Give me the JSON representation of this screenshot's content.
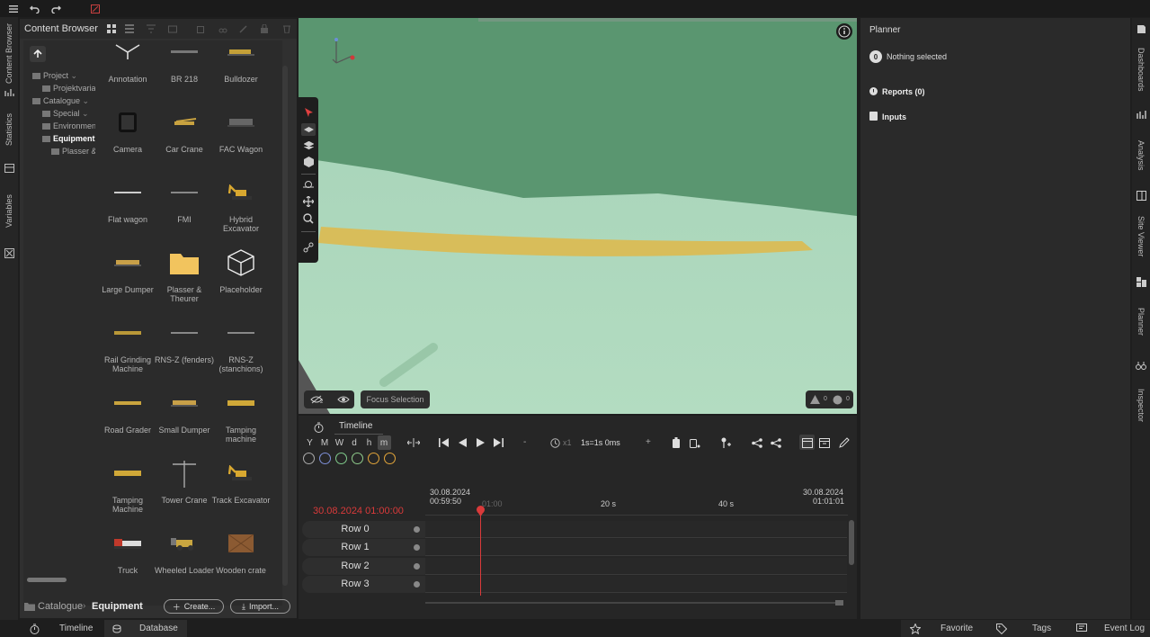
{
  "toolbar": {
    "menu_icon": "hamburger-icon",
    "undo_icon": "undo-icon",
    "redo_icon": "redo-icon"
  },
  "left_tabs": [
    "Content Browser",
    "Statistics",
    "Variables"
  ],
  "content_browser": {
    "title": "Content Browser",
    "tree": [
      {
        "label": "Project",
        "level": 0
      },
      {
        "label": "Projektvaria",
        "level": 1
      },
      {
        "label": "Catalogue",
        "level": 0
      },
      {
        "label": "Special",
        "level": 1
      },
      {
        "label": "Environmen",
        "level": 1
      },
      {
        "label": "Equipment",
        "level": 1,
        "selected": true
      },
      {
        "label": "Plasser &",
        "level": 2
      }
    ],
    "items": [
      {
        "label": "Annotation",
        "icon": "annotation-icon"
      },
      {
        "label": "BR 218",
        "icon": "locomotive-icon"
      },
      {
        "label": "Bulldozer",
        "icon": "bulldozer-icon"
      },
      {
        "label": "Camera",
        "icon": "camera-icon"
      },
      {
        "label": "Car Crane",
        "icon": "car-crane-icon"
      },
      {
        "label": "FAC Wagon",
        "icon": "wagon-icon"
      },
      {
        "label": "Flat wagon",
        "icon": "flat-wagon-icon"
      },
      {
        "label": "FMI",
        "icon": "fmi-icon"
      },
      {
        "label": "Hybrid Excavator",
        "icon": "excavator-icon"
      },
      {
        "label": "Large Dumper",
        "icon": "dumper-icon"
      },
      {
        "label": "Plasser & Theurer",
        "icon": "folder-icon"
      },
      {
        "label": "Placeholder",
        "icon": "cube-icon"
      },
      {
        "label": "Rail Grinding Machine",
        "icon": "rail-grinder-icon"
      },
      {
        "label": "RNS-Z (fenders)",
        "icon": "rns-icon"
      },
      {
        "label": "RNS-Z (stanchions)",
        "icon": "rns-icon"
      },
      {
        "label": "Road Grader",
        "icon": "grader-icon"
      },
      {
        "label": "Small Dumper",
        "icon": "dumper-icon"
      },
      {
        "label": "Tamping machine",
        "icon": "tamping-icon"
      },
      {
        "label": "Tamping Machine",
        "icon": "tamping-icon"
      },
      {
        "label": "Tower Crane",
        "icon": "tower-crane-icon"
      },
      {
        "label": "Track Excavator",
        "icon": "excavator-icon"
      },
      {
        "label": "Truck",
        "icon": "truck-icon"
      },
      {
        "label": "Wheeled Loader",
        "icon": "loader-icon"
      },
      {
        "label": "Wooden crate",
        "icon": "crate-icon"
      }
    ],
    "breadcrumb_root": "Catalogue",
    "breadcrumb_current": "Equipment",
    "create_label": "Create...",
    "import_label": "Import..."
  },
  "viewport": {
    "focus_selection": "Focus Selection",
    "warning_count": "0",
    "info_count": "0",
    "badge_count": "2"
  },
  "timeline": {
    "title": "Timeline",
    "scales": [
      "Y",
      "M",
      "W",
      "d",
      "h",
      "m"
    ],
    "active_scale": "m",
    "speed": "1s=1s 0ms",
    "speed_mult": "x1",
    "speed_minus": "-",
    "speed_plus": "+",
    "start_date": "30.08.2024",
    "start_time": "00:59:50",
    "end_date": "30.08.2024",
    "end_time": "01:01:01",
    "current": "30.08.2024 01:00:00",
    "ticks": [
      "01:00",
      "20 s",
      "40 s"
    ],
    "rows": [
      "Row 0",
      "Row 1",
      "Row 2",
      "Row 3"
    ],
    "colors": {
      "red": "#d93a3a",
      "circles": [
        "#aaaaaa",
        "#7d8fd6",
        "#7fc98a",
        "#8ec98a",
        "#e0a43a",
        "#e0a43a"
      ]
    }
  },
  "planner": {
    "title": "Planner",
    "nothing_count": "0",
    "nothing_label": "Nothing selected",
    "reports_label": "Reports (0)",
    "inputs_label": "Inputs"
  },
  "right_tabs": [
    "Dashboards",
    "Analysis",
    "Site Viewer",
    "Planner",
    "Inspector"
  ],
  "bottom": {
    "timeline": "Timeline",
    "database": "Database",
    "favorite": "Favorite",
    "tags": "Tags",
    "event_log": "Event Log"
  }
}
